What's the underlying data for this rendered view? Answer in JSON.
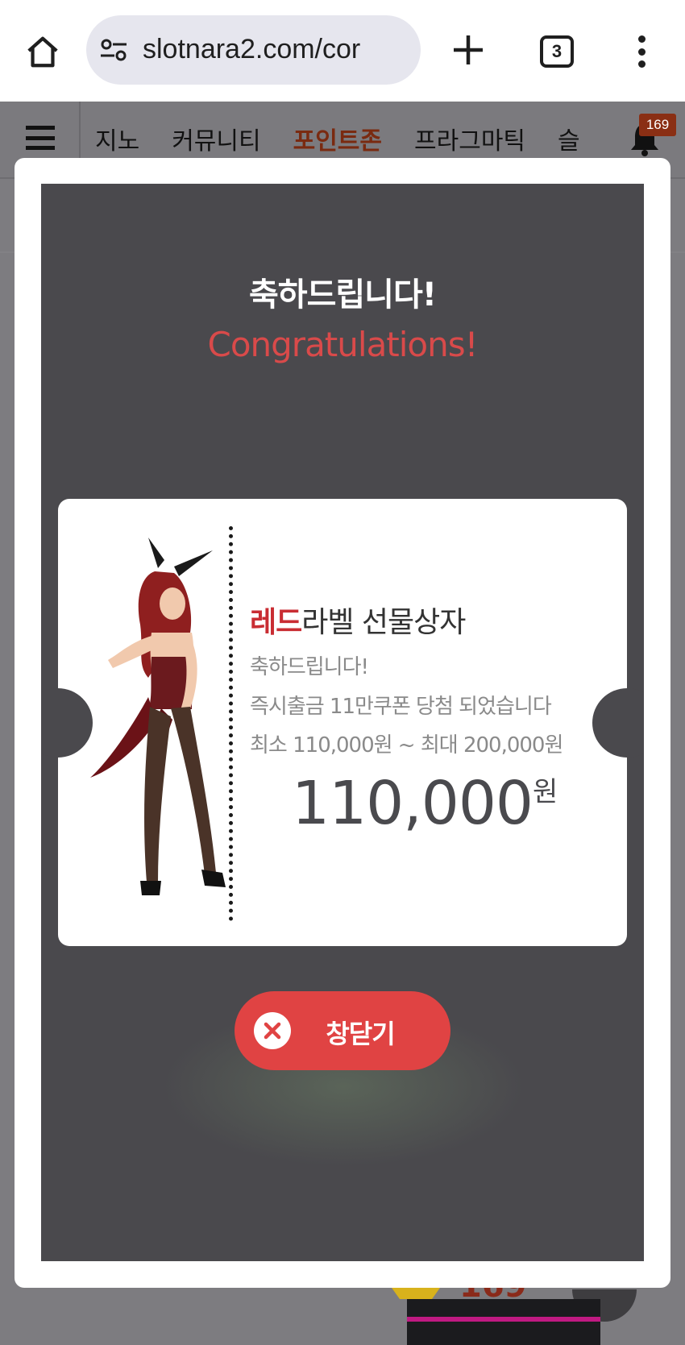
{
  "browser": {
    "url": "slotnara2.com/cor",
    "tab_count": "3"
  },
  "site_nav": {
    "items": [
      "지노",
      "커뮤니티",
      "포인트존",
      "프라그마틱",
      "슬"
    ],
    "active_index": 2,
    "notification_count": "169"
  },
  "modal": {
    "title_ko": "축하드립니다!",
    "title_en": "Congratulations!",
    "prize": {
      "title_highlight": "레드",
      "title_rest": "라벨 선물상자",
      "line1": "축하드립니다!",
      "line2": "즉시출금 11만쿠폰 당첨 되었습니다",
      "line3": "최소 110,000원 ~ 최대 200,000원",
      "amount": "110,000",
      "unit": "원"
    },
    "close_label": "창닫기"
  },
  "background_peek": {
    "text": "169"
  },
  "colors": {
    "accent_red": "#e04343",
    "title_red": "#d94a4a",
    "active_nav": "#7a2a10",
    "panel_bg": "#4a494d"
  }
}
